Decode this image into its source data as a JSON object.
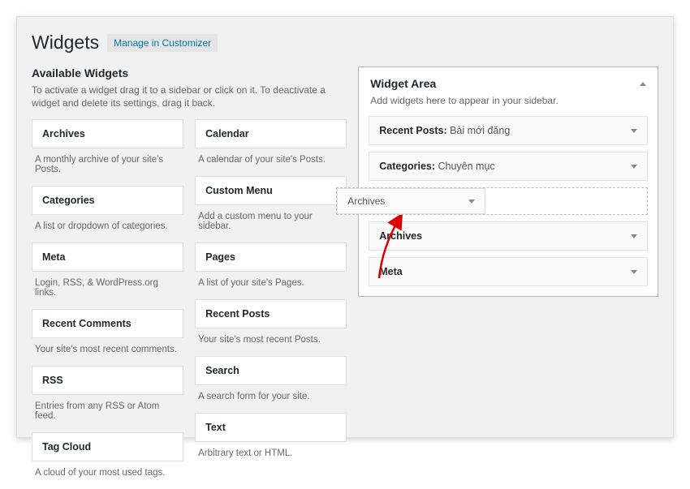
{
  "header": {
    "title": "Widgets",
    "manage_link": "Manage in Customizer"
  },
  "available": {
    "title": "Available Widgets",
    "desc": "To activate a widget drag it to a sidebar or click on it. To deactivate a widget and delete its settings, drag it back.",
    "col1": [
      {
        "name": "Archives",
        "desc": "A monthly archive of your site's Posts."
      },
      {
        "name": "Categories",
        "desc": "A list or dropdown of categories."
      },
      {
        "name": "Meta",
        "desc": "Login, RSS, & WordPress.org links."
      },
      {
        "name": "Recent Comments",
        "desc": "Your site's most recent comments."
      },
      {
        "name": "RSS",
        "desc": "Entries from any RSS or Atom feed."
      },
      {
        "name": "Tag Cloud",
        "desc": "A cloud of your most used tags."
      }
    ],
    "col2": [
      {
        "name": "Calendar",
        "desc": "A calendar of your site's Posts."
      },
      {
        "name": "Custom Menu",
        "desc": "Add a custom menu to your sidebar."
      },
      {
        "name": "Pages",
        "desc": "A list of your site's Pages."
      },
      {
        "name": "Recent Posts",
        "desc": "Your site's most recent Posts."
      },
      {
        "name": "Search",
        "desc": "A search form for your site."
      },
      {
        "name": "Text",
        "desc": "Arbitrary text or HTML."
      }
    ]
  },
  "area": {
    "title": "Widget Area",
    "desc": "Add widgets here to appear in your sidebar.",
    "widgets": [
      {
        "name": "Recent Posts:",
        "sub": " Bài mới đăng"
      },
      {
        "name": "Categories:",
        "sub": " Chuyên mục"
      }
    ],
    "drag_ghost": "Archives",
    "below": [
      {
        "name": "Archives",
        "sub": ""
      },
      {
        "name": "Meta",
        "sub": ""
      }
    ]
  }
}
